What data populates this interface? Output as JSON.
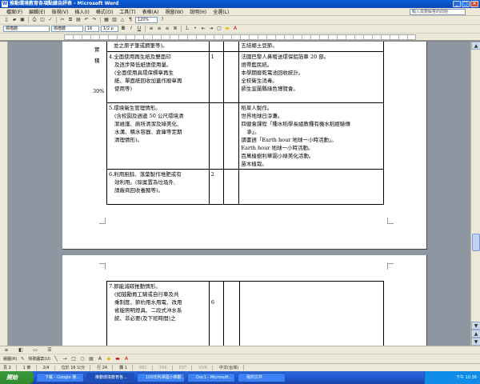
{
  "window": {
    "title": "推動環境教育各項點總自評表 - Microsoft Word"
  },
  "menu": [
    "檔案(F)",
    "編輯(E)",
    "檢視(V)",
    "插入(I)",
    "格式(O)",
    "工具(T)",
    "表格(A)",
    "視窗(W)",
    "說明(H)",
    "全選(L)"
  ],
  "help_placeholder": "輸入需要解答的問題",
  "toolbar": {
    "zoom": "120%",
    "style": "標楷體",
    "font": "標楷體",
    "size": "16",
    "fontsize2": "1/2 p"
  },
  "left_notes": [
    "實",
    "積",
    "30%"
  ],
  "page1_rows": [
    {
      "item": [
        "並之原子筆或鋼筆等)。"
      ],
      "score": "",
      "notes": [
        "五結鄉土豆節。"
      ]
    },
    {
      "item": [
        "4.全面使用再生紙及雙面印",
        "及逐步降低紙張使用量。",
        "(全面使用具環保標章再生",
        "紙、單面紙回收加蓋作廢章再",
        "使用等)"
      ],
      "score": "1",
      "notes": [
        "法國巴黎人鼻贈送環保鋁箔車 20 部。",
        "燈帶藍民統。",
        "本學期廢乾電池回收統計。",
        "全校衛生消毒。",
        "師生宣蘭縣綠色博覽會。"
      ]
    },
    {
      "item": [
        "5.環境衛生管理情形。",
        "(含校園及週邊 50 公尺環境清",
        "潔維護、廁所清潔及綠美化、",
        "水溝、積水容器、倉庫等定期",
        "清理情形)。"
      ],
      "score": "",
      "notes": [
        "稻草人製作。",
        "世界地球日淨灘。",
        "四健會課程「種水稻學長組教種有機水稻經驗傳",
        "承」。",
        "讀書週「Earth hour 地球一小時活動」。",
        "Earth hour 地球一小時活動。",
        "百萬植樹利華園小綠美化活動。",
        "苗木植栽。"
      ]
    },
    {
      "item": [
        "6.利用廚餘、落葉製作堆肥或有",
        "效利用。(除案置為垃圾外,",
        "請廠商回收養豬等)。"
      ],
      "score": "2",
      "notes": []
    }
  ],
  "page2_rows": [
    {
      "item": [
        "7.節能減碳推動情形。",
        "(如鼓勵員工騎或自行車及共",
        "乘制度、節約用水用電、改用",
        "省能照明燈具、二段式沖水系",
        "統、非必要(及下班時間)之"
      ],
      "score": "6",
      "notes": []
    }
  ],
  "statusbar": {
    "page": "頁 2",
    "section": "1 節",
    "pagecount": "2/4",
    "position": "位於 16 公分",
    "line": "行 24",
    "col": "欄 1",
    "flags": [
      "REC",
      "TRK",
      "EXT",
      "OVR"
    ],
    "lang": "中文(台灣)"
  },
  "drawbar": {
    "draw": "繪圖(R)",
    "autoshapes": "快取圖案(U)"
  },
  "taskbar": {
    "start": "開始",
    "tasks": [
      "下載 - Google 瀏...",
      "推動環境教育各...",
      "100年利澤國小推動...",
      "Doc1 - Microsoft...",
      "我的文件"
    ],
    "clock": "下午 10:36"
  }
}
